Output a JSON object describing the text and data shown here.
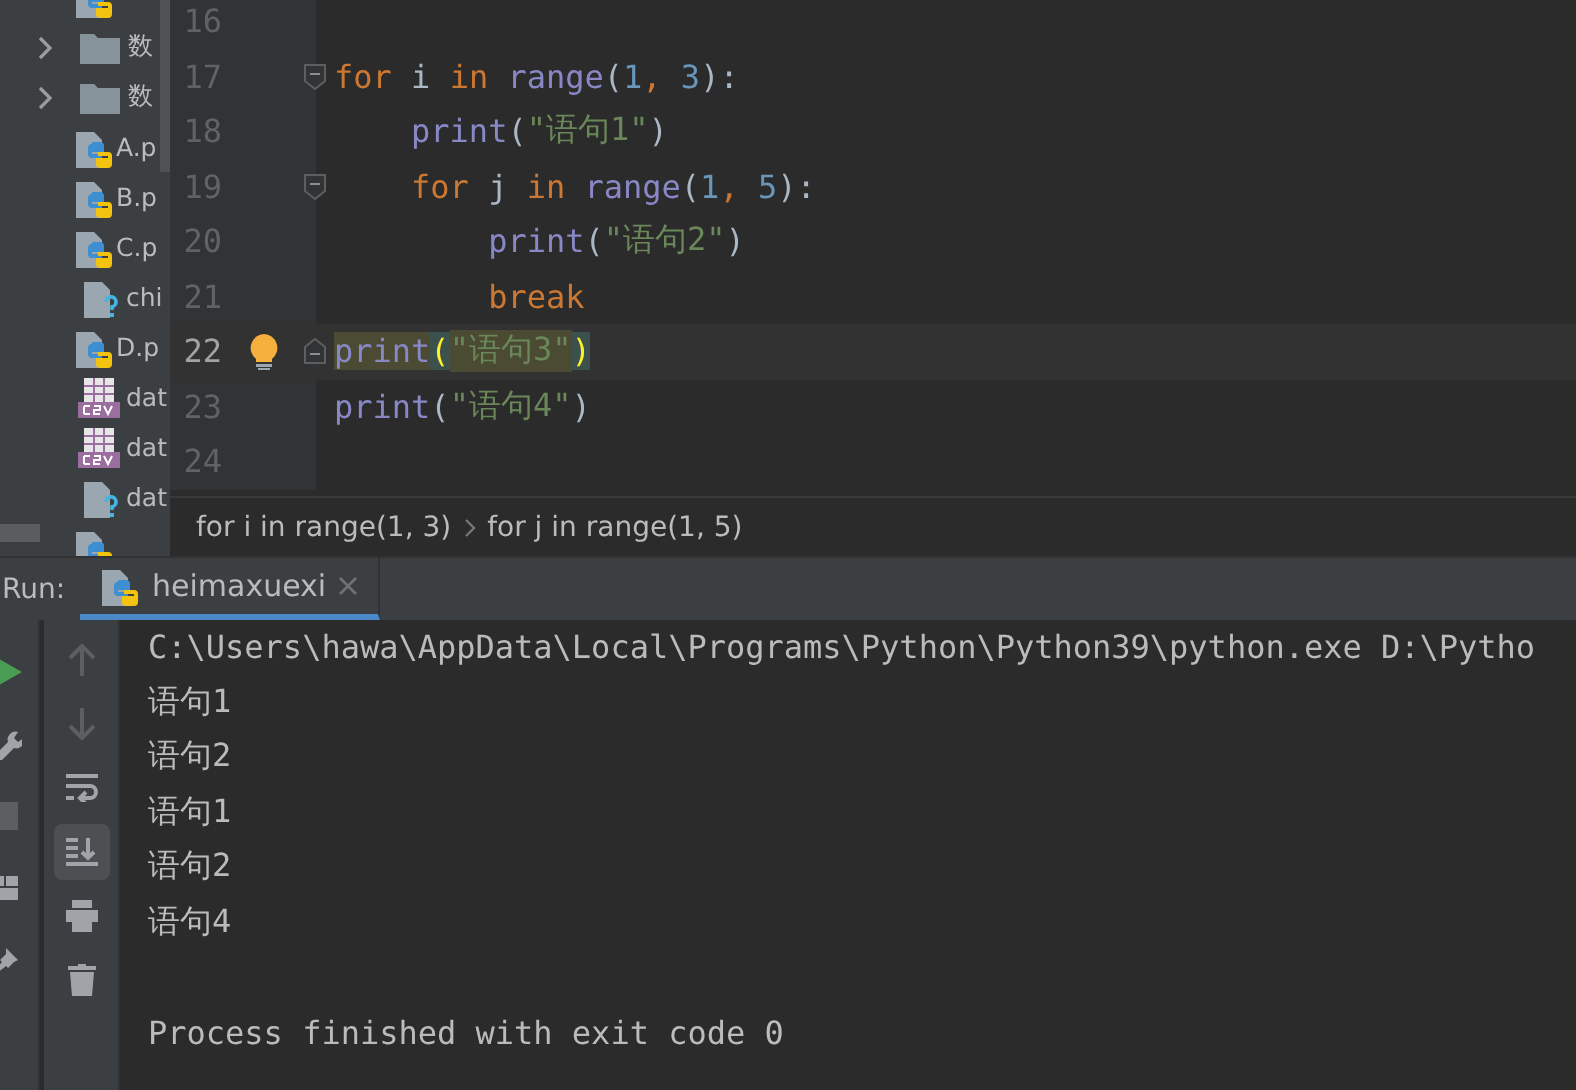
{
  "project_tree": {
    "items": [
      {
        "kind": "python"
      },
      {
        "kind": "folder",
        "label": "数"
      },
      {
        "kind": "folder",
        "label": "数"
      },
      {
        "kind": "python",
        "label": "A.p"
      },
      {
        "kind": "python",
        "label": "B.p"
      },
      {
        "kind": "python",
        "label": "C.p"
      },
      {
        "kind": "unknown",
        "label": "chi"
      },
      {
        "kind": "python",
        "label": "D.p"
      },
      {
        "kind": "csv",
        "label": "dat"
      },
      {
        "kind": "csv",
        "label": "dat"
      },
      {
        "kind": "unknown",
        "label": "dat"
      },
      {
        "kind": "python"
      }
    ]
  },
  "editor": {
    "lines": [
      {
        "number": "16",
        "kind": "plain",
        "current": false,
        "bulb": false
      },
      {
        "number": "17",
        "kind": "fold-start",
        "current": false,
        "bulb": false,
        "tokens": [
          {
            "kind": "keyword",
            "text": "for"
          },
          {
            "kind": "plain",
            "text": " i "
          },
          {
            "kind": "keyword",
            "text": "in"
          },
          {
            "kind": "func",
            "text": " range"
          },
          {
            "kind": "plain",
            "text": "("
          },
          {
            "kind": "number",
            "text": "1"
          },
          {
            "kind": "keyword",
            "text": ", "
          },
          {
            "kind": "number",
            "text": "3"
          },
          {
            "kind": "plain",
            "text": "):"
          }
        ]
      },
      {
        "number": "18",
        "kind": "plain",
        "current": false,
        "bulb": false,
        "tokens": [
          {
            "kind": "func",
            "text": "    print"
          },
          {
            "kind": "plain",
            "text": "("
          },
          {
            "kind": "string",
            "text": "\"语句1\""
          },
          {
            "kind": "plain",
            "text": ")"
          }
        ]
      },
      {
        "number": "19",
        "kind": "fold-start",
        "current": false,
        "bulb": false,
        "tokens": [
          {
            "kind": "keyword",
            "text": "    for"
          },
          {
            "kind": "plain",
            "text": " j "
          },
          {
            "kind": "keyword",
            "text": "in"
          },
          {
            "kind": "func",
            "text": " range"
          },
          {
            "kind": "plain",
            "text": "("
          },
          {
            "kind": "number",
            "text": "1"
          },
          {
            "kind": "keyword",
            "text": ", "
          },
          {
            "kind": "number",
            "text": "5"
          },
          {
            "kind": "plain",
            "text": "):"
          }
        ]
      },
      {
        "number": "20",
        "kind": "plain",
        "current": false,
        "bulb": false,
        "tokens": [
          {
            "kind": "func",
            "text": "        print"
          },
          {
            "kind": "plain",
            "text": "("
          },
          {
            "kind": "string",
            "text": "\"语句2\""
          },
          {
            "kind": "plain",
            "text": ")"
          }
        ]
      },
      {
        "number": "21",
        "kind": "plain",
        "current": false,
        "bulb": false,
        "tokens": [
          {
            "kind": "keyword",
            "text": "        break"
          }
        ]
      },
      {
        "number": "22",
        "kind": "fold-end",
        "current": true,
        "bulb": true,
        "tokens": [
          {
            "kind": "func-usage",
            "text": "print"
          },
          {
            "kind": "brace-match",
            "text": "("
          },
          {
            "kind": "string-usage",
            "text": "\"语句3\""
          },
          {
            "kind": "brace-match",
            "text": ")"
          }
        ]
      },
      {
        "number": "23",
        "kind": "plain",
        "current": false,
        "bulb": false,
        "tokens": [
          {
            "kind": "func",
            "text": "print"
          },
          {
            "kind": "plain",
            "text": "("
          },
          {
            "kind": "string",
            "text": "\"语句4\""
          },
          {
            "kind": "plain",
            "text": ")"
          }
        ]
      },
      {
        "number": "24",
        "kind": "plain",
        "current": false,
        "bulb": false
      }
    ],
    "breadcrumbs": [
      "for i in range(1, 3)",
      "for j in range(1, 5)"
    ]
  },
  "run": {
    "label": "Run:",
    "tabs": [
      {
        "title": "heimaxuexi",
        "selected": true
      }
    ],
    "left_tools": [
      {
        "kind": "run",
        "disabled": false
      },
      {
        "kind": "wrench",
        "disabled": false
      },
      {
        "kind": "stop",
        "disabled": true
      },
      {
        "kind": "layout",
        "disabled": false
      },
      {
        "kind": "pin",
        "disabled": false
      }
    ],
    "console_tools": [
      {
        "kind": "up",
        "disabled": true,
        "selected": false
      },
      {
        "kind": "down",
        "disabled": true,
        "selected": false
      },
      {
        "kind": "wrap",
        "disabled": false,
        "selected": false
      },
      {
        "kind": "scroll-end",
        "disabled": false,
        "selected": true
      },
      {
        "kind": "print",
        "disabled": false,
        "selected": false
      },
      {
        "kind": "trash",
        "disabled": false,
        "selected": false
      }
    ],
    "console": [
      {
        "kind": "command",
        "text": "C:\\Users\\hawa\\AppData\\Local\\Programs\\Python\\Python39\\python.exe D:\\Pytho"
      },
      {
        "kind": "output",
        "text": "语句1"
      },
      {
        "kind": "output",
        "text": "语句2"
      },
      {
        "kind": "output",
        "text": "语句1"
      },
      {
        "kind": "output",
        "text": "语句2"
      },
      {
        "kind": "output",
        "text": "语句4"
      },
      {
        "kind": "exit",
        "text": "Process finished with exit code 0"
      }
    ]
  }
}
